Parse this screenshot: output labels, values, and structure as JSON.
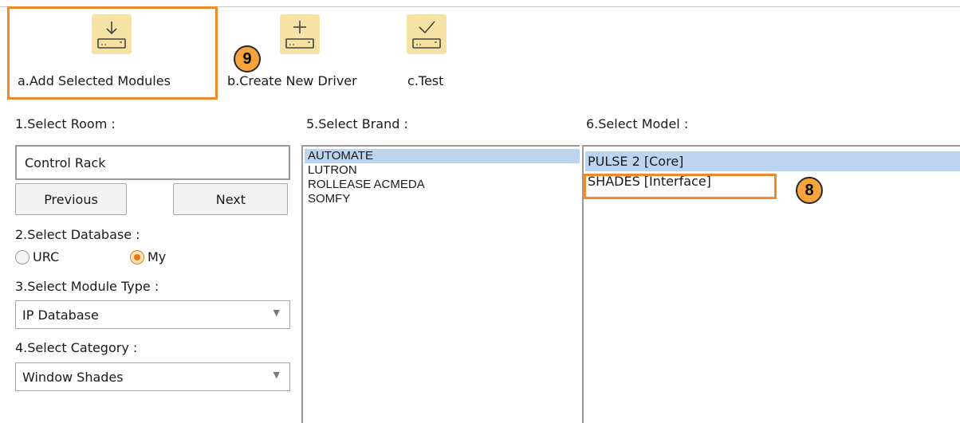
{
  "toolbar": {
    "buttons": [
      {
        "label": "a.Add Selected Modules",
        "icon": "download-device-icon"
      },
      {
        "label": "b.Create New Driver",
        "icon": "plus-device-icon"
      },
      {
        "label": "c.Test",
        "icon": "check-device-icon"
      }
    ],
    "icon_glyphs": [
      "↓",
      "+",
      "✓"
    ]
  },
  "annotations": {
    "badge_9": "9",
    "badge_8": "8",
    "highlight_color": "#f0892a",
    "badge_color": "#f7a33c"
  },
  "left_panel": {
    "room_label": "1.Select Room :",
    "room_value": "Control Rack",
    "previous_label": "Previous",
    "next_label": "Next",
    "database_label": "2.Select Database :",
    "database_options": [
      {
        "label": "URC",
        "selected": false
      },
      {
        "label": "My",
        "selected": true
      }
    ],
    "module_type_label": "3.Select Module Type :",
    "module_type_value": "IP Database",
    "category_label": "4.Select Category :",
    "category_value": "Window Shades"
  },
  "brand_panel": {
    "label": "5.Select Brand :",
    "items": [
      "AUTOMATE",
      "LUTRON",
      "ROLLEASE ACMEDA",
      "SOMFY"
    ],
    "selected_index": 0
  },
  "model_panel": {
    "label": "6.Select Model :",
    "items": [
      "PULSE 2 [Core]",
      "SHADES [Interface]"
    ],
    "selected_index": 0
  },
  "colors": {
    "icon_bg": "#f7e2a6",
    "selection": "#bcd4ee"
  }
}
